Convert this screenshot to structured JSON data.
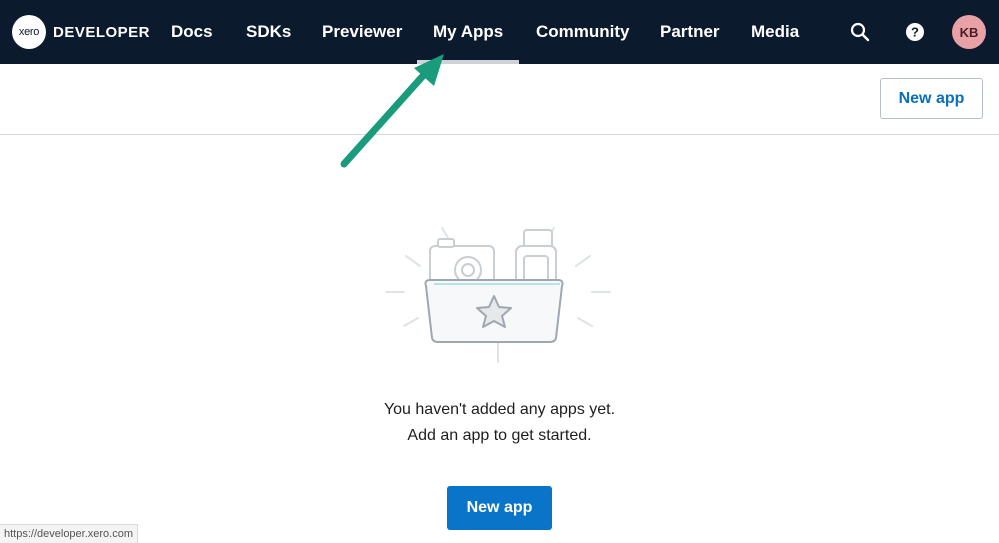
{
  "header": {
    "logo_mark": "xero",
    "logo_text": "DEVELOPER",
    "nav": [
      "Docs",
      "SDKs",
      "Previewer",
      "My Apps",
      "Community",
      "Partner",
      "Media"
    ],
    "active_nav": "My Apps",
    "user_initials": "KB",
    "icons": [
      "search-icon",
      "help-icon"
    ]
  },
  "toolbar": {
    "new_app_label": "New app"
  },
  "empty_state": {
    "line1": "You haven't added any apps yet.",
    "line2": "Add an app to get started.",
    "button_label": "New app"
  },
  "status_url": "https://developer.xero.com",
  "colors": {
    "nav_bg": "#0b1a2c",
    "primary": "#0a74c9",
    "link": "#0a6fbf",
    "avatar_bg": "#e8a1a6",
    "annotation_arrow": "#1a9b7c"
  }
}
